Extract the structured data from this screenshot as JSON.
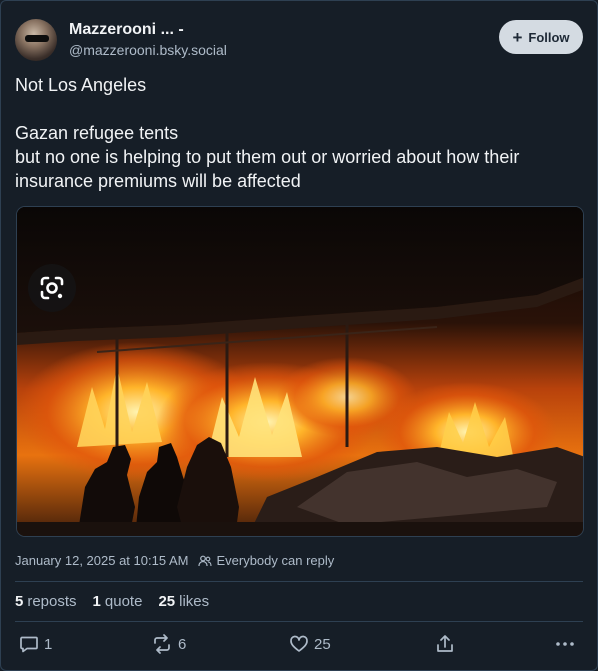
{
  "author": {
    "display_name": "Mazzerooni ... -",
    "handle": "@mazzerooni.bsky.social"
  },
  "follow_button": {
    "label": "Follow"
  },
  "post": {
    "line1": "Not Los Angeles",
    "line2": "Gazan refugee tents",
    "line3": "but no one is helping to put them out or worried about how their insurance premiums will be affected"
  },
  "meta": {
    "timestamp": "January 12, 2025 at 10:15 AM",
    "reply_setting": "Everybody can reply"
  },
  "stats": {
    "reposts_count": "5",
    "reposts_label": "reposts",
    "quotes_count": "1",
    "quotes_label": "quote",
    "likes_count": "25",
    "likes_label": "likes"
  },
  "actions": {
    "reply_count": "1",
    "repost_count": "6",
    "like_count": "25"
  },
  "colors": {
    "background": "#161e27",
    "text_primary": "#f1f3f5",
    "text_secondary": "#aebbc9",
    "follow_button_bg": "#d4dbe2",
    "divider": "#2e4052"
  }
}
